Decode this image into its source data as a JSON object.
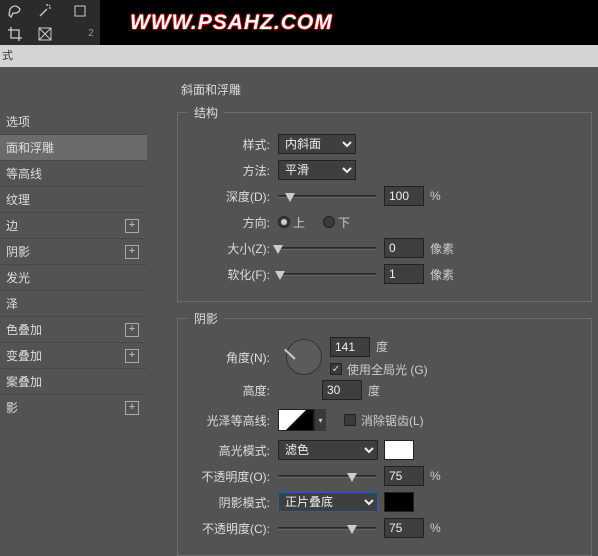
{
  "banner": {
    "url_text": "WWW.PSAHZ.COM"
  },
  "tab": {
    "label": "式"
  },
  "sidebar": {
    "section": "选项",
    "items": [
      {
        "label": "面和浮雕",
        "selected": true,
        "plus": false
      },
      {
        "label": "等高线",
        "plus": false
      },
      {
        "label": "纹理",
        "plus": false
      },
      {
        "label": "边",
        "plus": true
      },
      {
        "label": "阴影",
        "plus": true
      },
      {
        "label": "发光",
        "plus": false
      },
      {
        "label": "泽",
        "plus": false
      },
      {
        "label": "色叠加",
        "plus": true
      },
      {
        "label": "变叠加",
        "plus": true
      },
      {
        "label": "案叠加",
        "plus": false
      },
      {
        "label": "影",
        "plus": true
      }
    ]
  },
  "panel": {
    "title": "斜面和浮雕",
    "structure_legend": "结构",
    "style_label": "样式:",
    "style_value": "内斜面",
    "technique_label": "方法:",
    "technique_value": "平滑",
    "depth_label": "深度(D):",
    "depth_value": "100",
    "depth_unit": "%",
    "direction_label": "方向:",
    "direction_up": "上",
    "direction_down": "下",
    "size_label": "大小(Z):",
    "size_value": "0",
    "size_unit": "像素",
    "soften_label": "软化(F):",
    "soften_value": "1",
    "soften_unit": "像素",
    "shading_legend": "阴影",
    "angle_label": "角度(N):",
    "angle_value": "141",
    "angle_unit": "度",
    "global_light_label": "使用全局光 (G)",
    "altitude_label": "高度:",
    "altitude_value": "30",
    "altitude_unit": "度",
    "gloss_label": "光泽等高线:",
    "antialias_label": "消除锯齿(L)",
    "highlight_mode_label": "高光模式:",
    "highlight_mode_value": "滤色",
    "highlight_color": "#ffffff",
    "highlight_opacity_label": "不透明度(O):",
    "highlight_opacity_value": "75",
    "highlight_opacity_unit": "%",
    "shadow_mode_label": "阴影模式:",
    "shadow_mode_value": "正片叠底",
    "shadow_color": "#000000",
    "shadow_opacity_label": "不透明度(C):",
    "shadow_opacity_value": "75",
    "shadow_opacity_unit": "%"
  },
  "tools_number": "2"
}
